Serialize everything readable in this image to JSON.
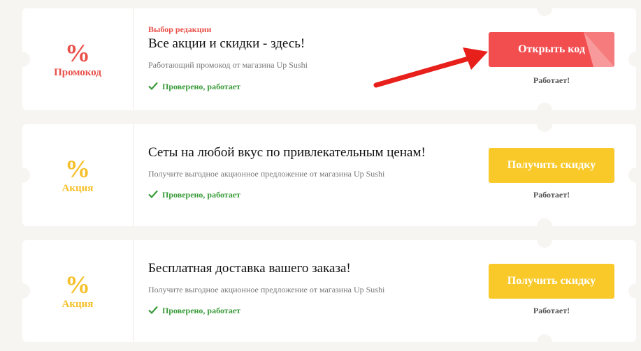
{
  "colors": {
    "page_bg": "#f7f5f1",
    "red": "#e8504a",
    "red_button": "#f24d4f",
    "yellow": "#f5c02a",
    "yellow_button": "#f8c928",
    "green": "#3a9b3a"
  },
  "coupons": [
    {
      "badge_symbol": "%",
      "badge_label": "Промокод",
      "editor_pick": "Выбор редакции",
      "title": "Все акции и скидки - здесь!",
      "description": "Работающий промокод от магазина Up Sushi",
      "verified": "Проверено, работает",
      "button_label": "Открыть код",
      "status": "Работает!"
    },
    {
      "badge_symbol": "%",
      "badge_label": "Акция",
      "title": "Сеты на любой вкус по привлекательным ценам!",
      "description": "Получите выгодное акционное предложение от магазина Up Sushi",
      "verified": "Проверено, работает",
      "button_label": "Получить скидку",
      "status": "Работает!"
    },
    {
      "badge_symbol": "%",
      "badge_label": "Акция",
      "title": "Бесплатная доставка вашего заказа!",
      "description": "Получите выгодное акционное предложение от магазина Up Sushi",
      "verified": "Проверено, работает",
      "button_label": "Получить скидку",
      "status": "Работает!"
    }
  ],
  "icons": {
    "verified": "check-icon",
    "annotation": "red-arrow-icon",
    "button_corner": "peel-corner-icon"
  }
}
